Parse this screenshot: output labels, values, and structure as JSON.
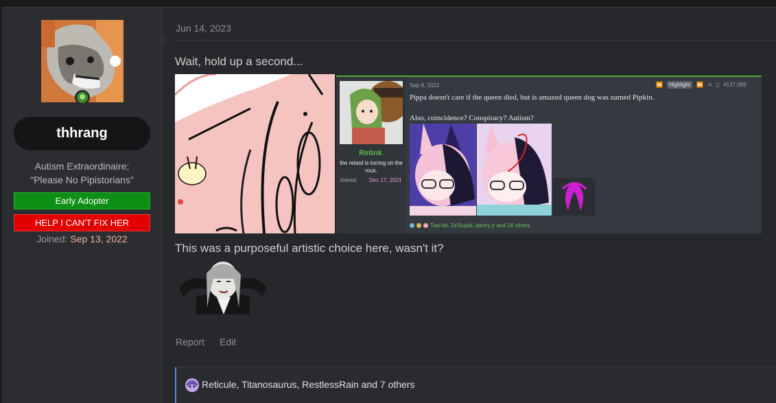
{
  "user": {
    "username": "thhrang",
    "title_line1": "Autism Extraordinaire;",
    "title_line2": "\"Please No Pipistorians\"",
    "banner_1": "Early Adopter",
    "banner_2": "HELP I CAN'T FIX HER",
    "joined_label": "Joined:",
    "joined_date": "Sep 13, 2022",
    "online_status_icon": "online-indicator-icon"
  },
  "post": {
    "date": "Jun 14, 2023",
    "line1": "Wait, hold up a second...",
    "line2": "This was a purposeful artistic choice here, wasn't it?",
    "actions": {
      "report": "Report",
      "edit": "Edit"
    },
    "reactions_text": "Reticule, Titanosaurus, RestlessRain and 7 others"
  },
  "embedded_post": {
    "author": "Retink",
    "author_title": "the retard is torring on the roux.",
    "joined_label": "Joined:",
    "joined_date": "Dec 17, 2021",
    "date": "Sep 8, 2022",
    "highlight_label": "Highlight",
    "post_number": "#137,089",
    "text1": "Pippa doesn't care if the queen died, but is amazed queen dog was named Pipkin.",
    "text2": "Also, coincidence? Conspiracy? Autism?",
    "reactions": "Two-bit, DrStupid, danny jr and 18 others"
  },
  "colors": {
    "accent_joined": "#f2b3a1",
    "banner_green": "#0d8e14",
    "banner_red": "#e00000",
    "embed_accent": "#56b847"
  }
}
